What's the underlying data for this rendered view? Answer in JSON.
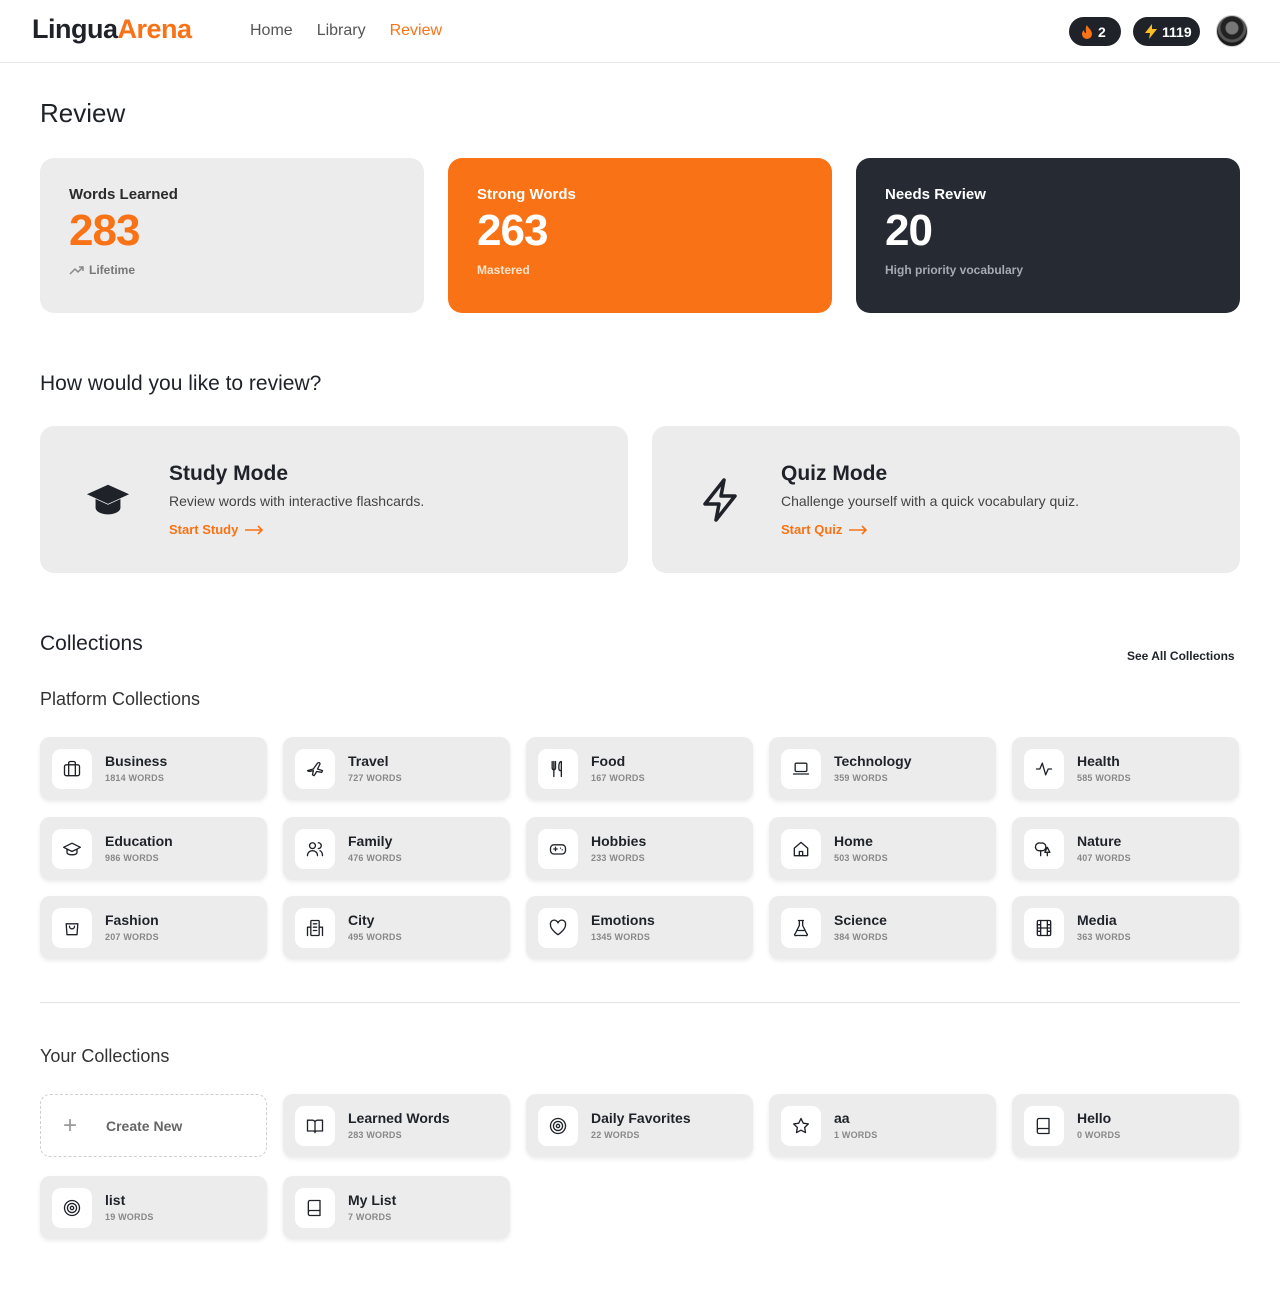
{
  "header": {
    "logo_part1": "Lingua",
    "logo_part2": "Arena",
    "nav": [
      {
        "label": "Home",
        "active": false
      },
      {
        "label": "Library",
        "active": false
      },
      {
        "label": "Review",
        "active": true
      }
    ],
    "streak": "2",
    "xp": "1119"
  },
  "page_title": "Review",
  "stats": {
    "learned": {
      "label": "Words Learned",
      "value": "283",
      "note": "Lifetime"
    },
    "strong": {
      "label": "Strong Words",
      "value": "263",
      "note": "Mastered"
    },
    "review": {
      "label": "Needs Review",
      "value": "20",
      "note": "High priority vocabulary"
    }
  },
  "modes_title": "How would you like to review?",
  "modes": {
    "study": {
      "title": "Study Mode",
      "desc": "Review words with interactive flashcards.",
      "link": "Start Study"
    },
    "quiz": {
      "title": "Quiz Mode",
      "desc": "Challenge yourself with a quick vocabulary quiz.",
      "link": "Start Quiz"
    }
  },
  "collections_title": "Collections",
  "see_all": "See All Collections",
  "platform_title": "Platform Collections",
  "platform_collections": [
    {
      "name": "Business",
      "count": "1814 WORDS",
      "icon": "briefcase-icon"
    },
    {
      "name": "Travel",
      "count": "727 WORDS",
      "icon": "plane-icon"
    },
    {
      "name": "Food",
      "count": "167 WORDS",
      "icon": "utensils-icon"
    },
    {
      "name": "Technology",
      "count": "359 WORDS",
      "icon": "laptop-icon"
    },
    {
      "name": "Health",
      "count": "585 WORDS",
      "icon": "pulse-icon"
    },
    {
      "name": "Education",
      "count": "986 WORDS",
      "icon": "graduation-cap-icon"
    },
    {
      "name": "Family",
      "count": "476 WORDS",
      "icon": "users-icon"
    },
    {
      "name": "Hobbies",
      "count": "233 WORDS",
      "icon": "gamepad-icon"
    },
    {
      "name": "Home",
      "count": "503 WORDS",
      "icon": "house-icon"
    },
    {
      "name": "Nature",
      "count": "407 WORDS",
      "icon": "trees-icon"
    },
    {
      "name": "Fashion",
      "count": "207 WORDS",
      "icon": "shopping-bag-icon"
    },
    {
      "name": "City",
      "count": "495 WORDS",
      "icon": "building-icon"
    },
    {
      "name": "Emotions",
      "count": "1345 WORDS",
      "icon": "heart-icon"
    },
    {
      "name": "Science",
      "count": "384 WORDS",
      "icon": "flask-icon"
    },
    {
      "name": "Media",
      "count": "363 WORDS",
      "icon": "film-icon"
    }
  ],
  "your_title": "Your Collections",
  "create_label": "Create New",
  "your_collections": [
    {
      "name": "Learned Words",
      "count": "283 WORDS",
      "icon": "book-open-icon"
    },
    {
      "name": "Daily Favorites",
      "count": "22 WORDS",
      "icon": "target-icon"
    },
    {
      "name": "aa",
      "count": "1 WORDS",
      "icon": "star-icon"
    },
    {
      "name": "Hello",
      "count": "0 WORDS",
      "icon": "book-icon"
    },
    {
      "name": "list",
      "count": "19 WORDS",
      "icon": "target-icon"
    },
    {
      "name": "My List",
      "count": "7 WORDS",
      "icon": "book-icon"
    }
  ],
  "colors": {
    "accent": "#f97316",
    "dark": "#262b33",
    "card": "#ececec"
  }
}
